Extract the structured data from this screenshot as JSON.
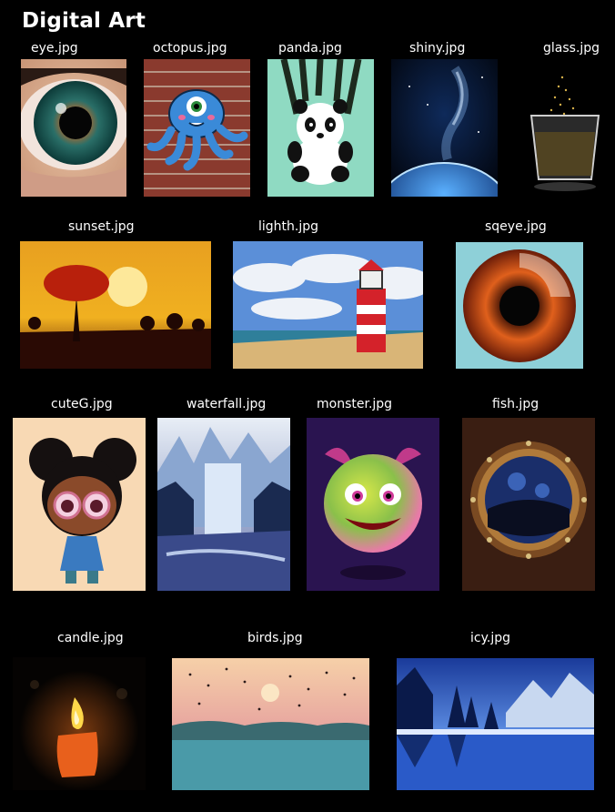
{
  "page_title": "Digital Art",
  "images": [
    {
      "caption": "eye.jpg",
      "subject": "eye"
    },
    {
      "caption": "octopus.jpg",
      "subject": "octopus"
    },
    {
      "caption": "panda.jpg",
      "subject": "panda"
    },
    {
      "caption": "shiny.jpg",
      "subject": "earth"
    },
    {
      "caption": "glass.jpg",
      "subject": "glass"
    },
    {
      "caption": "sunset.jpg",
      "subject": "sunset"
    },
    {
      "caption": "lighth.jpg",
      "subject": "lighthouse"
    },
    {
      "caption": "sqeye.jpg",
      "subject": "eye"
    },
    {
      "caption": "cuteG.jpg",
      "subject": "girl"
    },
    {
      "caption": "waterfall.jpg",
      "subject": "waterfall"
    },
    {
      "caption": "monster.jpg",
      "subject": "monster"
    },
    {
      "caption": "fish.jpg",
      "subject": "porthole"
    },
    {
      "caption": "candle.jpg",
      "subject": "candle"
    },
    {
      "caption": "birds.jpg",
      "subject": "birds"
    },
    {
      "caption": "icy.jpg",
      "subject": "lake"
    }
  ]
}
